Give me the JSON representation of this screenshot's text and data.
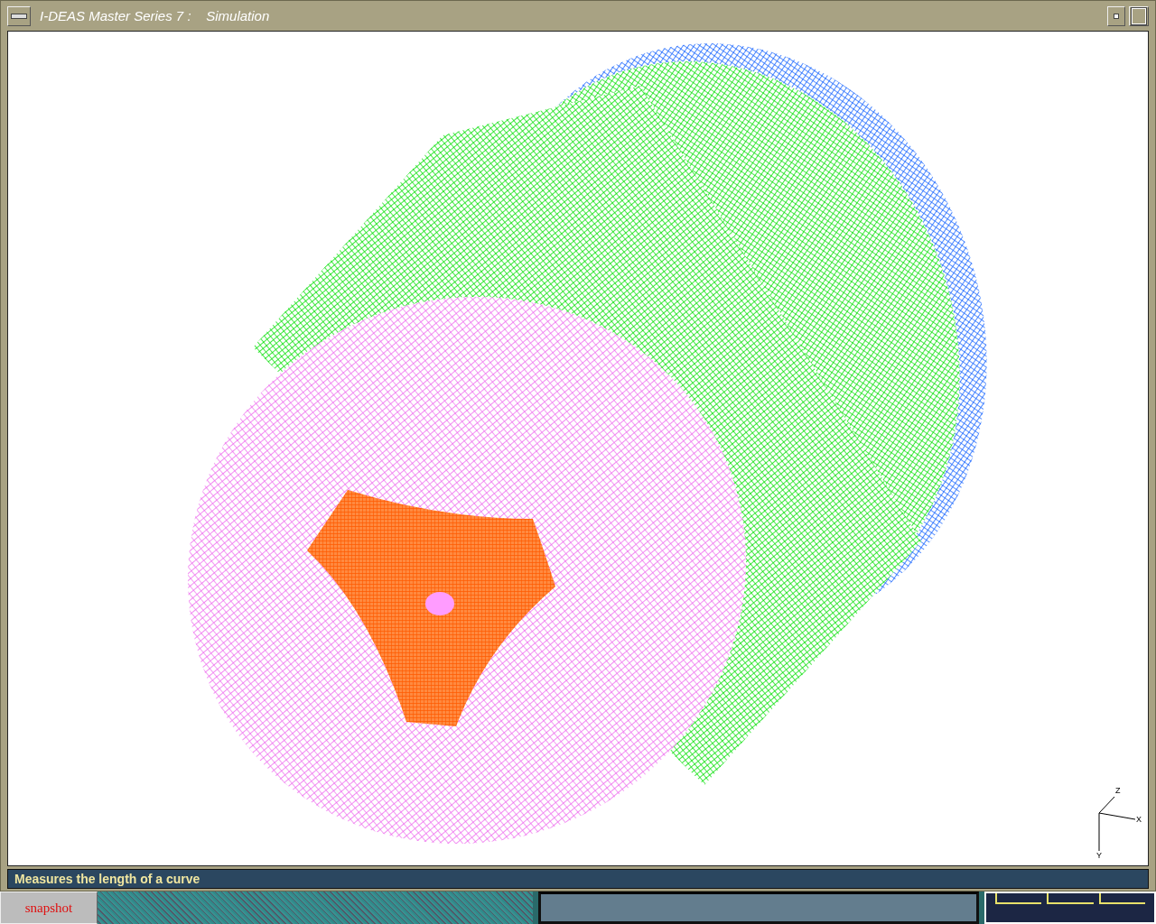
{
  "window": {
    "title": "I-DEAS Master Series 7 :    Simulation"
  },
  "viewport": {
    "axes": [
      "Z",
      "X",
      "Y"
    ]
  },
  "status_bar": {
    "message": "Measures the length of a curve"
  },
  "taskbar": {
    "button": "snapshot"
  }
}
